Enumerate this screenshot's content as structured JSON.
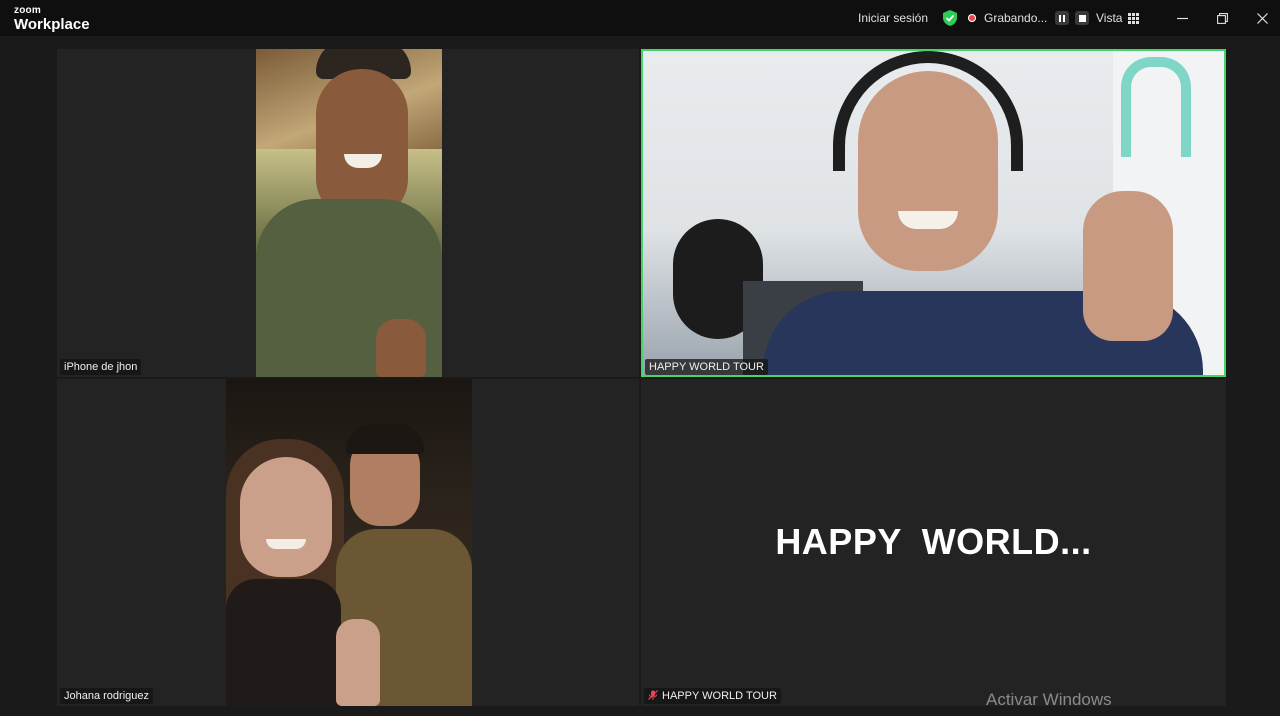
{
  "app": {
    "brand_small": "zoom",
    "brand_big": "Workplace"
  },
  "toolbar": {
    "sign_in": "Iniciar sesión",
    "recording": "Grabando...",
    "view": "Vista"
  },
  "tiles": [
    {
      "name": "iPhone de jhon",
      "muted": false,
      "active": false
    },
    {
      "name": "HAPPY WORLD TOUR",
      "muted": false,
      "active": true
    },
    {
      "name": "Johana rodriguez",
      "muted": false,
      "active": false
    },
    {
      "name": "HAPPY WORLD TOUR",
      "muted": true,
      "active": false,
      "display_name": "HAPPY  WORLD..."
    }
  ],
  "watermark": "Activar Windows",
  "colors": {
    "active_speaker_border": "#46d36a",
    "recording_dot": "#e5484d",
    "background": "#1a1a1a",
    "tile": "#232323"
  },
  "icons": {
    "security": "shield-check-icon",
    "recording": "record-dot-icon",
    "pause": "pause-icon",
    "stop": "stop-icon",
    "view": "grid-view-icon",
    "muted": "mic-muted-icon"
  }
}
